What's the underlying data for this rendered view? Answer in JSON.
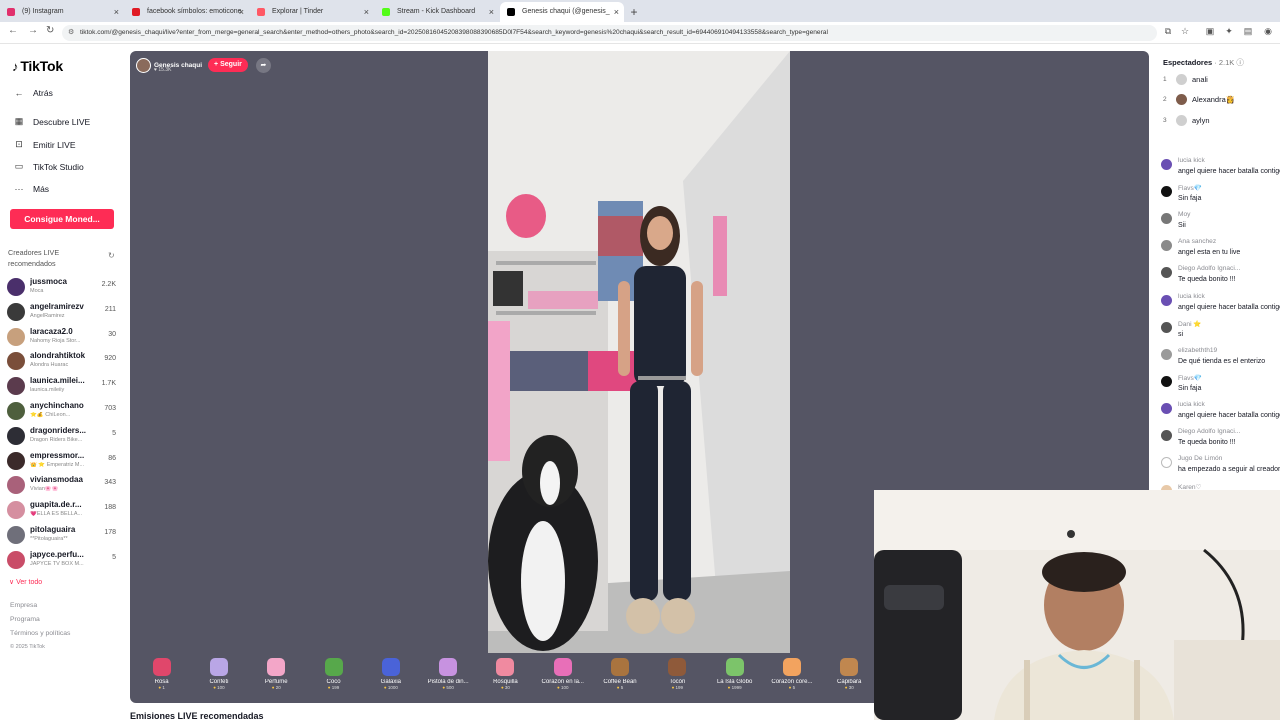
{
  "browser": {
    "tabs": [
      {
        "title": "(9) Instagram",
        "color": "#e1306c",
        "active": false
      },
      {
        "title": "facebook símbolos: emoticone",
        "color": "#e01b24",
        "active": false
      },
      {
        "title": "Explorar | Tinder",
        "color": "#ff5864",
        "active": false
      },
      {
        "title": "Stream - Kick Dashboard",
        "color": "#53fc18",
        "active": false
      },
      {
        "title": "Genesis chaqui (@genesis_",
        "color": "#000000",
        "active": true
      }
    ],
    "new_tab": "+",
    "url": "tiktok.com/@genesis_chaqui/live?enter_from_merge=general_search&enter_method=others_photo&search_id=20250816045208398088390685D0l7F54&search_keyword=genesis%20chaqui&search_result_id=694406910494133558&search_type=general"
  },
  "sidebar": {
    "logo": "TikTok",
    "back": "Atrás",
    "nav": [
      {
        "label": "Descubre LIVE",
        "icon": "calendar-icon"
      },
      {
        "label": "Emitir LIVE",
        "icon": "broadcast-icon"
      },
      {
        "label": "TikTok Studio",
        "icon": "studio-icon"
      },
      {
        "label": "Más",
        "icon": "more-icon"
      }
    ],
    "coins_button": "Consigue Moned...",
    "recommended_title": "Creadores LIVE recomendados",
    "creators": [
      {
        "name": "jussmoca",
        "sub": "Moca",
        "count": "2.2K",
        "color": "#4a2f6b"
      },
      {
        "name": "angelramirezv",
        "sub": "AngelRamirez",
        "count": "211",
        "color": "#3a3a3a"
      },
      {
        "name": "laracaza2.0",
        "sub": "Nahomy Rioja Stor...",
        "count": "30",
        "color": "#c7a07d"
      },
      {
        "name": "alondrahtiktok",
        "sub": "Alondra Huarac",
        "count": "920",
        "color": "#7a4e3a"
      },
      {
        "name": "launica.milei...",
        "sub": "launica.mileiiy",
        "count": "1.7K",
        "color": "#5b3b4d"
      },
      {
        "name": "anychinchano",
        "sub": "⭐💰 ChiLeon...",
        "count": "703",
        "color": "#4e5f3d"
      },
      {
        "name": "dragonriders...",
        "sub": "Dragon Riders Bike...",
        "count": "5",
        "color": "#2d2d35"
      },
      {
        "name": "empressmor...",
        "sub": "👑 ⭐ Emperatriz M...",
        "count": "86",
        "color": "#3b2a2a"
      },
      {
        "name": "viviansmodaa",
        "sub": "Vivian🌸🌸",
        "count": "343",
        "color": "#a9617a"
      },
      {
        "name": "guapita.de.r...",
        "sub": "💗ELLA ES BELLA...",
        "count": "188",
        "color": "#d58fa0"
      },
      {
        "name": "pitolaguaira",
        "sub": "**Pitolaguaira**",
        "count": "178",
        "color": "#6f6f7a"
      },
      {
        "name": "japyce.perfu...",
        "sub": "JAPYCE TV BOX M...",
        "count": "5",
        "color": "#c94d68"
      }
    ],
    "see_all": "Ver todo",
    "footer": [
      "Empresa",
      "Programa",
      "Términos y políticas",
      "© 2025 TikTok"
    ]
  },
  "player": {
    "host_name": "Genesis chaqui",
    "host_likes": "♥ 15.3K",
    "follow_label": "+ Seguir",
    "gifts": [
      {
        "name": "Rosa",
        "price": "1",
        "color": "#e0476b"
      },
      {
        "name": "Confeti",
        "price": "100",
        "color": "#b9a6e6"
      },
      {
        "name": "Perfume",
        "price": "20",
        "color": "#f3a6c8"
      },
      {
        "name": "Coco",
        "price": "199",
        "color": "#57a84b"
      },
      {
        "name": "Galaxia",
        "price": "1000",
        "color": "#4a63d8"
      },
      {
        "name": "Pistola de din...",
        "price": "500",
        "color": "#c792e0"
      },
      {
        "name": "Rosquilla",
        "price": "30",
        "color": "#f08aa0"
      },
      {
        "name": "Corazón en la...",
        "price": "100",
        "color": "#e86fb8"
      },
      {
        "name": "Coffee Bean",
        "price": "5",
        "color": "#a9743f"
      },
      {
        "name": "Tocón",
        "price": "199",
        "color": "#8f5a3a"
      },
      {
        "name": "La Isla Globo",
        "price": "1999",
        "color": "#7cc46a"
      },
      {
        "name": "Corazón core...",
        "price": "5",
        "color": "#f2a35f"
      },
      {
        "name": "Capibara",
        "price": "30",
        "color": "#c0874f"
      }
    ]
  },
  "below_player": "Emisiones LIVE recomendadas",
  "chat": {
    "spectators_label": "Espectadores",
    "spectators_count": "· 2.1K",
    "top_viewers": [
      {
        "rank": "1",
        "name": "anali",
        "color": "#cfcfcf"
      },
      {
        "rank": "2",
        "name": "Alexandra👸",
        "color": "#7e5c4b"
      },
      {
        "rank": "3",
        "name": "aylyn",
        "color": "#cfcfcf"
      }
    ],
    "messages": [
      {
        "user": "lucia kick",
        "text": "angel quiere hacer batalla contigo",
        "color": "#6a4fb3"
      },
      {
        "user": "Flavs💎",
        "text": "Sin faja",
        "color": "#111111"
      },
      {
        "user": "Moy",
        "text": "Sii",
        "color": "#777777"
      },
      {
        "user": "Ana sanchez",
        "text": "angel esta en tu live",
        "color": "#8a8a8a"
      },
      {
        "user": "Diego Adolfo Ignaci...",
        "text": "Te queda bonito !!!",
        "color": "#555555"
      },
      {
        "user": "lucia kick",
        "text": "angel quiere hacer batalla contigo",
        "color": "#6a4fb3"
      },
      {
        "user": "Dani ⭐",
        "text": "si",
        "color": "#555555"
      },
      {
        "user": "elizabethth19",
        "text": "De qué tienda es el enterizo",
        "color": "#9a9a9a"
      },
      {
        "user": "Flavs💎",
        "text": "Sin faja",
        "color": "#111111"
      },
      {
        "user": "lucia kick",
        "text": "angel quiere hacer batalla contigo",
        "color": "#6a4fb3"
      },
      {
        "user": "Diego Adolfo Ignaci...",
        "text": "Te queda bonito !!!",
        "color": "#555555"
      },
      {
        "user": "Jugo De Limón",
        "text": "ha empezado a seguir al creador",
        "color": "#ffffff"
      }
    ],
    "partial_user": "Karen♡"
  }
}
